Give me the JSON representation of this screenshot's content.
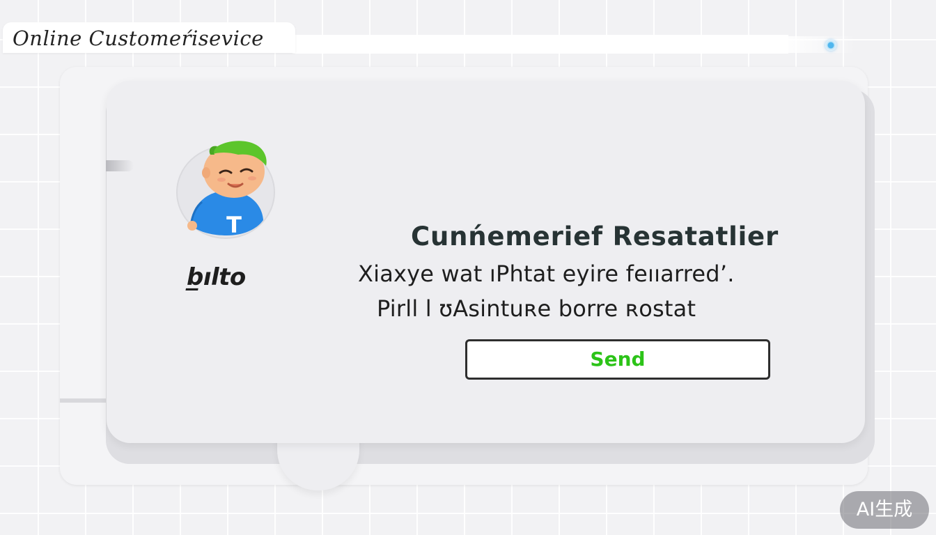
{
  "window": {
    "title": "Online Customeŕisevice"
  },
  "status_indicator": {
    "color": "#4fb6ee"
  },
  "agent": {
    "name": "b̲ılto",
    "avatar_letter": "T",
    "avatar_colors": {
      "hair": "#5cc52b",
      "skin": "#f6b98a",
      "shirt": "#2a8ae6"
    }
  },
  "message": {
    "heading": "Cunńemerief Resatatlier",
    "line1": "Xiaxye wat ıPhtat  eyire feııarred’.",
    "line2": "Pirll  l ʊAsintuʀe borre ʀostat",
    "send_label": "Send",
    "send_label_color": "#2cc318"
  },
  "watermark": {
    "text": "AI生成"
  }
}
